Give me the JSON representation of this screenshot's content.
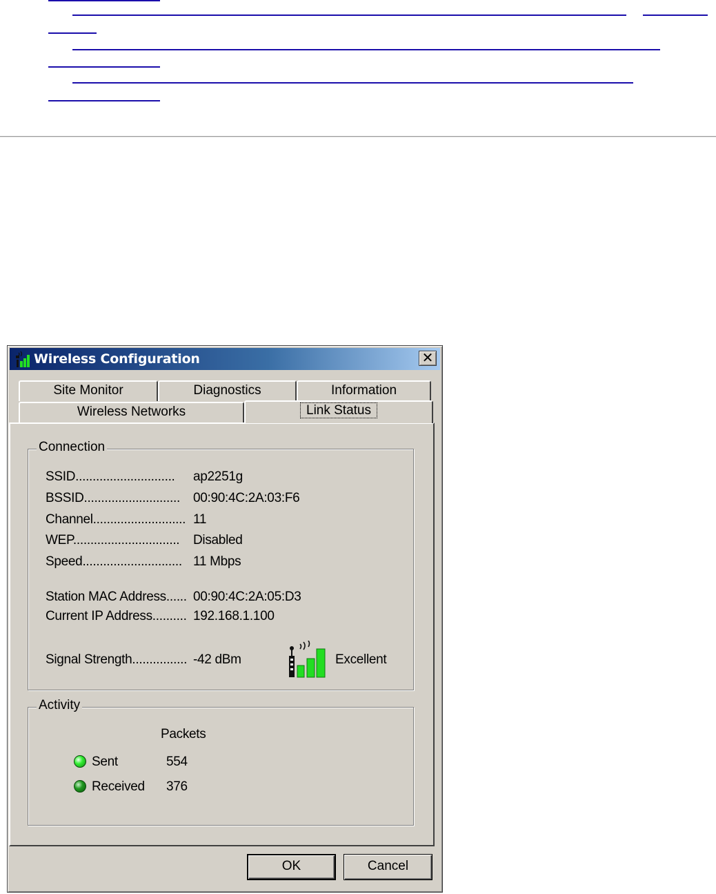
{
  "window": {
    "title": "Wireless Configuration",
    "close_label": "✕"
  },
  "tabs": {
    "row1": [
      "Site Monitor",
      "Diagnostics",
      "Information"
    ],
    "row2": [
      "Wireless Networks",
      "Link Status"
    ],
    "active": "Link Status"
  },
  "connection": {
    "legend": "Connection",
    "fields": [
      {
        "label": "SSID.............................",
        "value": "ap2251g"
      },
      {
        "label": "BSSID............................",
        "value": "00:90:4C:2A:03:F6"
      },
      {
        "label": "Channel...........................",
        "value": "11"
      },
      {
        "label": "WEP...............................",
        "value": "Disabled"
      },
      {
        "label": "Speed.............................",
        "value": "11 Mbps"
      },
      {
        "label": "Station MAC Address......",
        "value": "00:90:4C:2A:05:D3"
      },
      {
        "label": "Current IP Address..........",
        "value": "192.168.1.100"
      },
      {
        "label": "Signal Strength................",
        "value": "-42 dBm"
      }
    ],
    "signal_quality": "Excellent",
    "signal_icon": "signal-strength-icon"
  },
  "activity": {
    "legend": "Activity",
    "column_header": "Packets",
    "rows": [
      {
        "label": "Sent",
        "value": "554",
        "led_color": "#22cc22"
      },
      {
        "label": "Received",
        "value": "376",
        "led_color": "#118811"
      }
    ]
  },
  "buttons": {
    "ok": "OK",
    "cancel": "Cancel"
  },
  "colors": {
    "link": "#1a0dab",
    "title_start": "#0a246a",
    "title_end": "#a6caf0",
    "dialog_face": "#d4d0c8",
    "signal_green": "#22cc22"
  }
}
